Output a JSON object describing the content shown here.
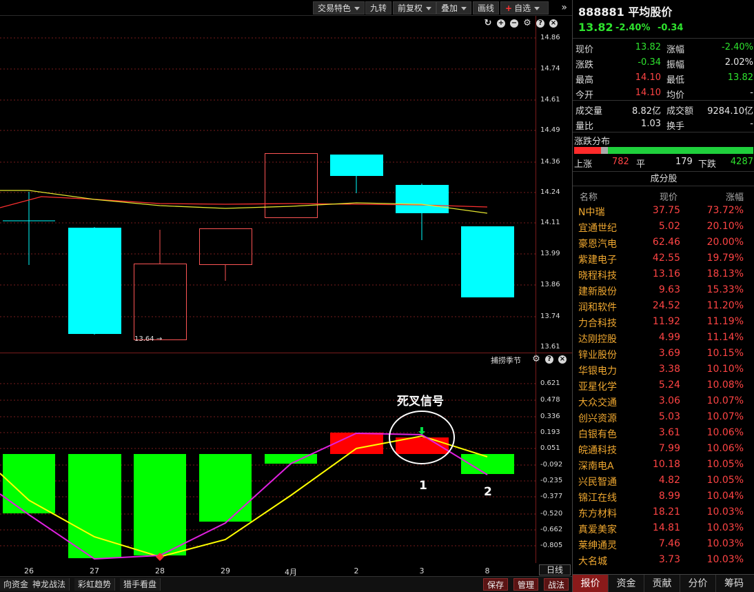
{
  "toolbar": {
    "buttons": [
      "交易特色",
      "九转",
      "前复权",
      "叠加",
      "画线",
      "自选"
    ],
    "more": "»"
  },
  "price_axis": [
    "14.86",
    "14.74",
    "14.61",
    "14.49",
    "14.36",
    "14.24",
    "14.11",
    "13.99",
    "13.86",
    "13.74",
    "13.61"
  ],
  "low_label": "13.64",
  "indicator": {
    "title": "捕捞季节",
    "axis": [
      "0.621",
      "0.478",
      "0.336",
      "0.193",
      "0.051",
      "-0.092",
      "-0.235",
      "-0.377",
      "-0.520",
      "-0.662",
      "-0.805"
    ]
  },
  "x_labels": [
    "26",
    "27",
    "28",
    "29",
    "4月",
    "2",
    "3",
    "8"
  ],
  "period_label": "日线",
  "annotation": {
    "text": "死叉信号",
    "n1": "1",
    "n2": "2"
  },
  "bottom_tabs": [
    "向资金",
    "神龙战法",
    "彩虹趋势",
    "猎手看盘"
  ],
  "bottom_right_buttons": [
    "保存",
    "管理",
    "战法"
  ],
  "quote": {
    "code": "888881",
    "name": "平均股价",
    "price": "13.82",
    "change_pct": "-2.40%",
    "change": "-0.34",
    "rows": [
      {
        "l1": "现价",
        "v1": "13.82",
        "l2": "涨幅",
        "v2": "-2.40%"
      },
      {
        "l1": "涨跌",
        "v1": "-0.34",
        "l2": "振幅",
        "v2": "2.02%"
      },
      {
        "l1": "最高",
        "v1": "14.10",
        "l2": "最低",
        "v2": "13.82"
      },
      {
        "l1": "今开",
        "v1": "14.10",
        "l2": "均价",
        "v2": "-"
      },
      {
        "l1": "成交量",
        "v1": "8.82亿",
        "l2": "成交额",
        "v2": "9284.10亿"
      },
      {
        "l1": "量比",
        "v1": "1.03",
        "l2": "换手",
        "v2": "-"
      }
    ]
  },
  "distribution": {
    "title": "涨跌分布",
    "up_label": "上涨",
    "up": "782",
    "flat_label": "平",
    "flat": "179",
    "down_label": "下跌",
    "down": "4287"
  },
  "components": {
    "title": "成分股",
    "headers": [
      "名称",
      "现价",
      "涨幅"
    ],
    "rows": [
      {
        "name": "N中瑞",
        "price": "37.75",
        "pct": "73.72%"
      },
      {
        "name": "宜通世纪",
        "price": "5.02",
        "pct": "20.10%"
      },
      {
        "name": "豪恩汽电",
        "price": "62.46",
        "pct": "20.00%"
      },
      {
        "name": "紫建电子",
        "price": "42.55",
        "pct": "19.79%"
      },
      {
        "name": "晓程科技",
        "price": "13.16",
        "pct": "18.13%"
      },
      {
        "name": "建新股份",
        "price": "9.63",
        "pct": "15.33%"
      },
      {
        "name": "润和软件",
        "price": "24.52",
        "pct": "11.20%"
      },
      {
        "name": "力合科技",
        "price": "11.92",
        "pct": "11.19%"
      },
      {
        "name": "达刚控股",
        "price": "4.99",
        "pct": "11.14%"
      },
      {
        "name": "锌业股份",
        "price": "3.69",
        "pct": "10.15%"
      },
      {
        "name": "华银电力",
        "price": "3.38",
        "pct": "10.10%"
      },
      {
        "name": "亚星化学",
        "price": "5.24",
        "pct": "10.08%"
      },
      {
        "name": "大众交通",
        "price": "3.06",
        "pct": "10.07%"
      },
      {
        "name": "创兴资源",
        "price": "5.03",
        "pct": "10.07%"
      },
      {
        "name": "白银有色",
        "price": "3.61",
        "pct": "10.06%"
      },
      {
        "name": "皖通科技",
        "price": "7.99",
        "pct": "10.06%"
      },
      {
        "name": "深南电A",
        "price": "10.18",
        "pct": "10.05%"
      },
      {
        "name": "兴民智通",
        "price": "4.82",
        "pct": "10.05%"
      },
      {
        "name": "锦江在线",
        "price": "8.99",
        "pct": "10.04%"
      },
      {
        "name": "东方材料",
        "price": "18.21",
        "pct": "10.03%"
      },
      {
        "name": "真爱美家",
        "price": "14.81",
        "pct": "10.03%"
      },
      {
        "name": "莱绅通灵",
        "price": "7.46",
        "pct": "10.03%"
      },
      {
        "name": "大名城",
        "price": "3.73",
        "pct": "10.03%"
      }
    ]
  },
  "right_tabs": [
    "报价",
    "资金",
    "贡献",
    "分价",
    "筹码"
  ]
}
